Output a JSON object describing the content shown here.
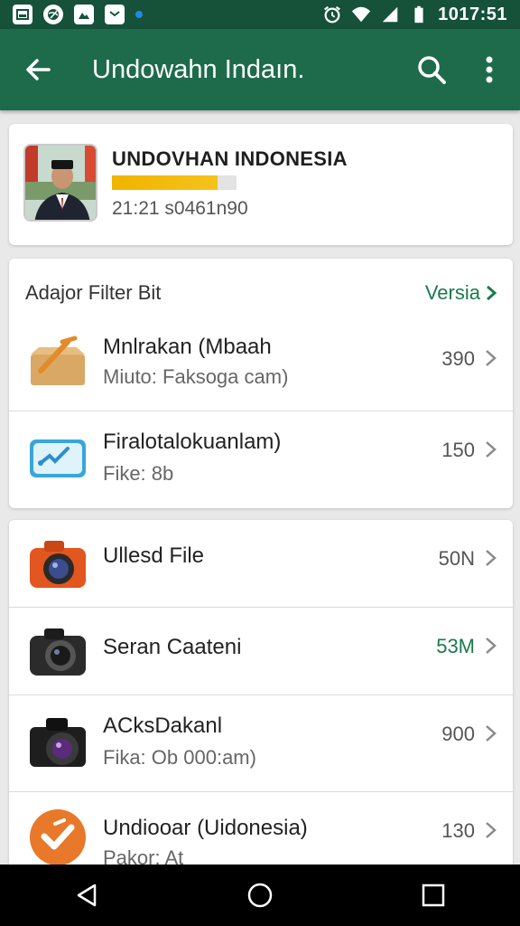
{
  "status_bar": {
    "time": "1017:51",
    "icons": [
      "notification-icon",
      "globe-icon",
      "image-icon",
      "mail-icon",
      "alarm-icon",
      "wifi-icon",
      "signal-icon",
      "battery-icon"
    ]
  },
  "appbar": {
    "title": "Undowahn Indaın.",
    "color": "#1e6b4c"
  },
  "profile": {
    "name": "UNDOVHAN INDONESIA",
    "meta": "21:21 s0461n90",
    "progress": 0.85
  },
  "files": {
    "header_title": "Adajor Filter Bit",
    "header_link": "Versia",
    "rows": [
      {
        "title": "Mnlrakan (Mbaah",
        "subtitle": "Miuto: Faksoga cam)",
        "value": "390",
        "icon": "box-icon"
      },
      {
        "title": "Firalotalokuanlam)",
        "subtitle": "Fike: 8b",
        "value": "150",
        "icon": "chart-card-icon"
      }
    ]
  },
  "media": {
    "rows": [
      {
        "title": "Ullesd File",
        "subtitle": "",
        "value": "50N",
        "icon": "orange-camera-icon",
        "value_color": "#555555"
      },
      {
        "title": "Seran Caateni",
        "subtitle": "",
        "value": "53M",
        "icon": "black-camera-icon",
        "value_color": "#1b7a4f"
      },
      {
        "title": "ACksDakanl",
        "subtitle": "Fika: Ob 000:am)",
        "value": "900",
        "icon": "purple-lens-camera-icon",
        "value_color": "#555555"
      },
      {
        "title": "Undiooar (Uidonesia)",
        "subtitle": "Pakor: At",
        "value": "130",
        "icon": "orange-check-badge-icon",
        "value_color": "#555555"
      }
    ]
  },
  "accent": "#1b7a4f"
}
